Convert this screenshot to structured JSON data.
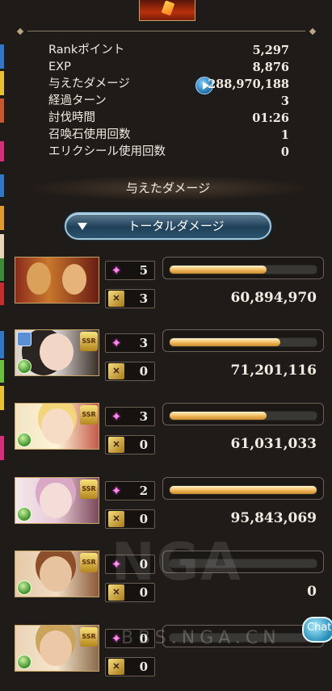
{
  "stats": [
    {
      "label": "Rankポイント",
      "value": "5,297"
    },
    {
      "label": "EXP",
      "value": "8,876"
    },
    {
      "label": "与えたダメージ",
      "value": "288,970,188"
    },
    {
      "label": "経過ターン",
      "value": "3"
    },
    {
      "label": "討伐時間",
      "value": "01:26"
    },
    {
      "label": "召喚石使用回数",
      "value": "1"
    },
    {
      "label": "エリクシール使用回数",
      "value": "0"
    }
  ],
  "section_title": "与えたダメージ",
  "tab_label": "トータルダメージ",
  "members": [
    {
      "star_count": "5",
      "chain_count": "3",
      "damage": "60,894,970",
      "damage_share": 0.66,
      "badge": "",
      "portrait": "main-character-pair"
    },
    {
      "star_count": "3",
      "chain_count": "0",
      "damage": "71,201,116",
      "damage_share": 0.75,
      "badge": "SSR",
      "portrait": "dark-haired-girl"
    },
    {
      "star_count": "3",
      "chain_count": "0",
      "damage": "61,031,033",
      "damage_share": 0.66,
      "badge": "SSR",
      "portrait": "blonde-girl"
    },
    {
      "star_count": "2",
      "chain_count": "0",
      "damage": "95,843,069",
      "damage_share": 1.0,
      "badge": "SSR",
      "portrait": "pink-haired-girl"
    },
    {
      "star_count": "0",
      "chain_count": "0",
      "damage": "0",
      "damage_share": 0,
      "badge": "SSR",
      "portrait": "brown-haired-man"
    },
    {
      "star_count": "0",
      "chain_count": "0",
      "damage": "",
      "damage_share": 0,
      "badge": "SSR",
      "portrait": "blond-man"
    }
  ],
  "watermark": "NGA",
  "watermark_sub": "BBS.NGA.CN",
  "chat_label": "Chat",
  "colors": {
    "background": "#1f1b18",
    "gauge_fill": "#f0b85a",
    "tab_accent": "#1f4058"
  },
  "icons": [
    "play-icon",
    "special-star-icon",
    "chain-burst-icon",
    "earth-element-icon",
    "ssr-badge-icon",
    "chat-icon"
  ]
}
